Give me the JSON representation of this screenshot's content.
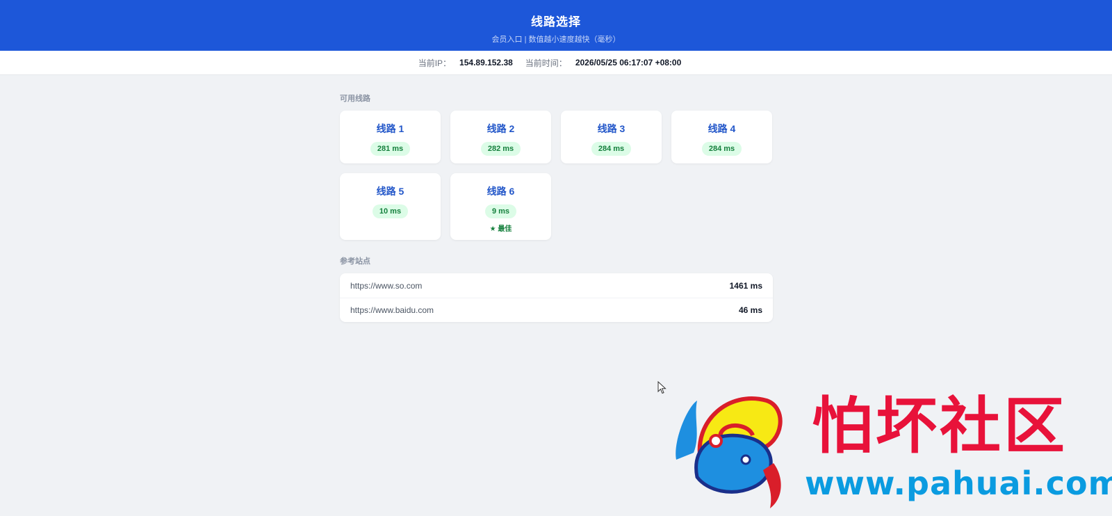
{
  "header": {
    "title": "线路选择",
    "subtitle": "会员入口 | 数值越小速度越快（毫秒）"
  },
  "info": {
    "ip_label": "当前IP：",
    "ip_value": "154.89.152.38",
    "time_label": "当前时间：",
    "time_value": "2026/05/25 06:17:07 +08:00"
  },
  "routes": {
    "section_title": "可用线路",
    "items": [
      {
        "name": "线路 1",
        "latency": "281 ms"
      },
      {
        "name": "线路 2",
        "latency": "282 ms"
      },
      {
        "name": "线路 3",
        "latency": "284 ms"
      },
      {
        "name": "线路 4",
        "latency": "284 ms"
      },
      {
        "name": "线路 5",
        "latency": "10 ms"
      },
      {
        "name": "线路 6",
        "latency": "9 ms",
        "best": "★ 最佳"
      }
    ]
  },
  "reference": {
    "section_title": "参考站点",
    "items": [
      {
        "url": "https://www.so.com",
        "latency": "1461 ms"
      },
      {
        "url": "https://www.baidu.com",
        "latency": "46 ms"
      }
    ]
  },
  "watermark": {
    "text": "怕坏社区",
    "url": "www.pahuai.com"
  },
  "colors": {
    "header_bg": "#1d57d9",
    "route_name": "#2357c9",
    "latency_badge_bg": "#dcfce7",
    "latency_badge_text": "#15803d",
    "watermark_red": "#e8123a",
    "watermark_blue": "#0a9be0"
  }
}
